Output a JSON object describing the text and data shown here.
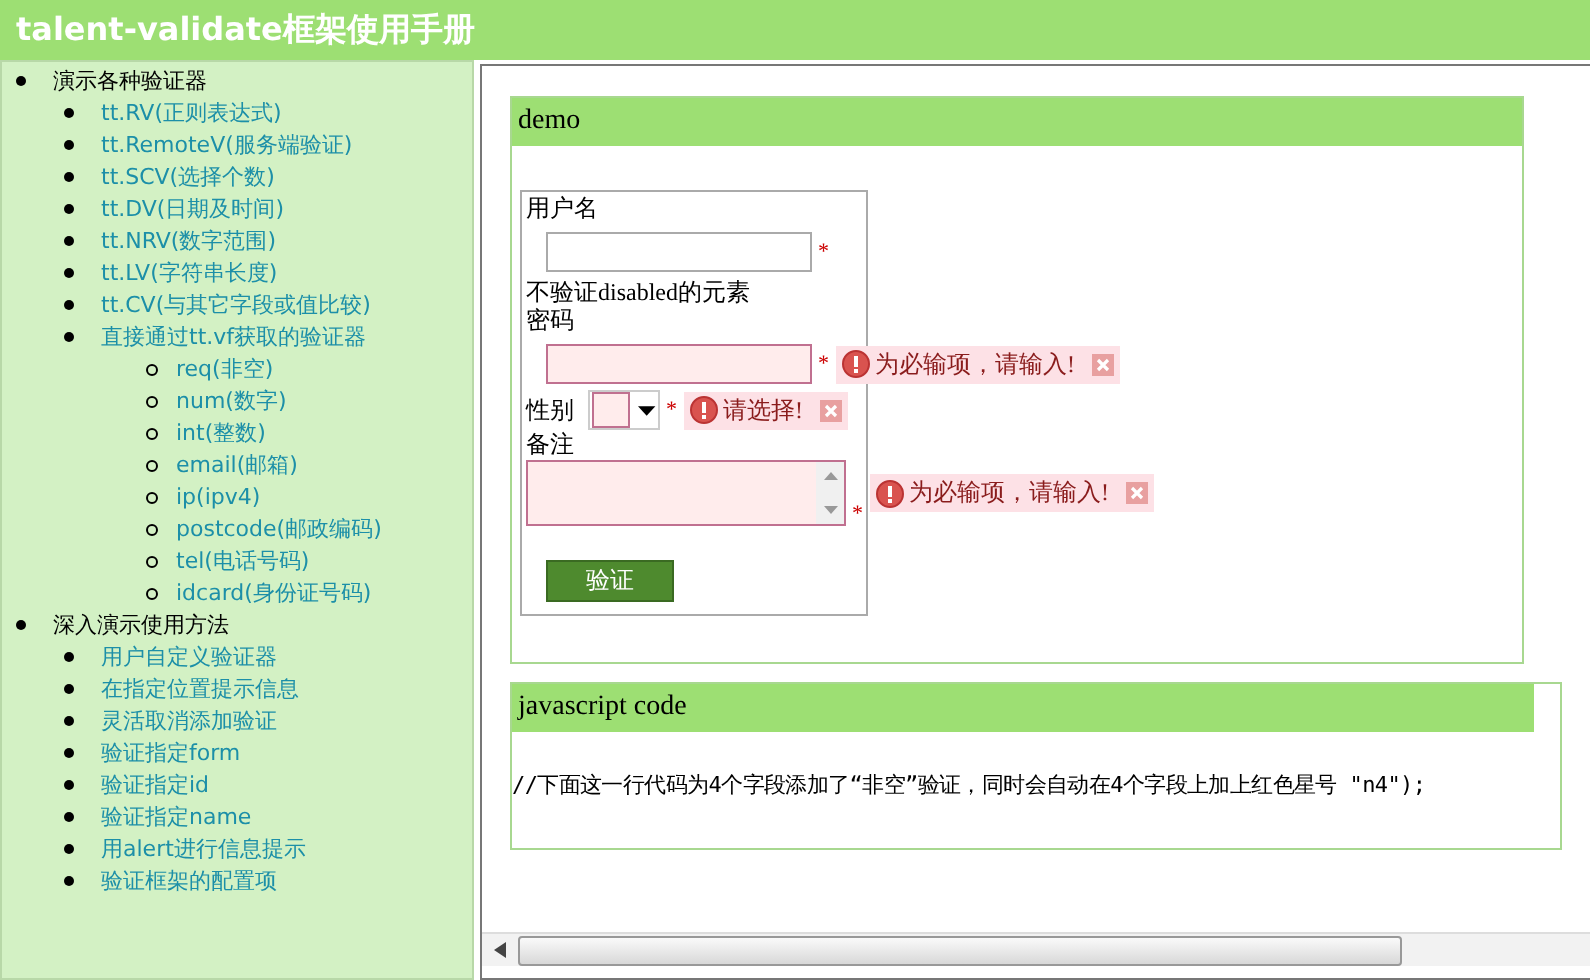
{
  "title": "talent-validate框架使用手册",
  "sidebar": {
    "sections": [
      {
        "label": "演示各种验证器",
        "items": [
          {
            "label": "tt.RV(正则表达式)"
          },
          {
            "label": "tt.RemoteV(服务端验证)"
          },
          {
            "label": "tt.SCV(选择个数)"
          },
          {
            "label": "tt.DV(日期及时间)"
          },
          {
            "label": "tt.NRV(数字范围)"
          },
          {
            "label": "tt.LV(字符串长度)"
          },
          {
            "label": "tt.CV(与其它字段或值比较)"
          },
          {
            "label": "直接通过tt.vf获取的验证器",
            "children": [
              {
                "label": "req(非空)"
              },
              {
                "label": "num(数字)"
              },
              {
                "label": "int(整数)"
              },
              {
                "label": "email(邮箱)"
              },
              {
                "label": "ip(ipv4)"
              },
              {
                "label": "postcode(邮政编码)"
              },
              {
                "label": "tel(电话号码)"
              },
              {
                "label": "idcard(身份证号码)"
              }
            ]
          }
        ]
      },
      {
        "label": "深入演示使用方法",
        "items": [
          {
            "label": "用户自定义验证器"
          },
          {
            "label": "在指定位置提示信息"
          },
          {
            "label": "灵活取消添加验证"
          },
          {
            "label": "验证指定form"
          },
          {
            "label": "验证指定id"
          },
          {
            "label": "验证指定name"
          },
          {
            "label": "用alert进行信息提示"
          },
          {
            "label": "验证框架的配置项"
          }
        ]
      }
    ]
  },
  "demo": {
    "title": "demo",
    "fields": [
      {
        "kind": "text",
        "label": "用户名",
        "required_mark": "*",
        "invalid": false
      },
      {
        "kind": "note",
        "label": "不验证disabled的元素"
      },
      {
        "kind": "text",
        "label": "密码",
        "required_mark": "*",
        "invalid": true,
        "error": "为必输项，请输入!"
      },
      {
        "kind": "select",
        "label": "性别",
        "required_mark": "*",
        "invalid": true,
        "error": "请选择!"
      },
      {
        "kind": "textarea",
        "label": "备注",
        "required_mark": "*",
        "invalid": true,
        "error": "为必输项，请输入!"
      }
    ],
    "button": "验证"
  },
  "code_panel": {
    "title": "javascript code",
    "code": "//下面这一行代码为4个字段添加了“非空”验证，同时会自动在4个字段上加上红色星号 \"n4\");"
  }
}
